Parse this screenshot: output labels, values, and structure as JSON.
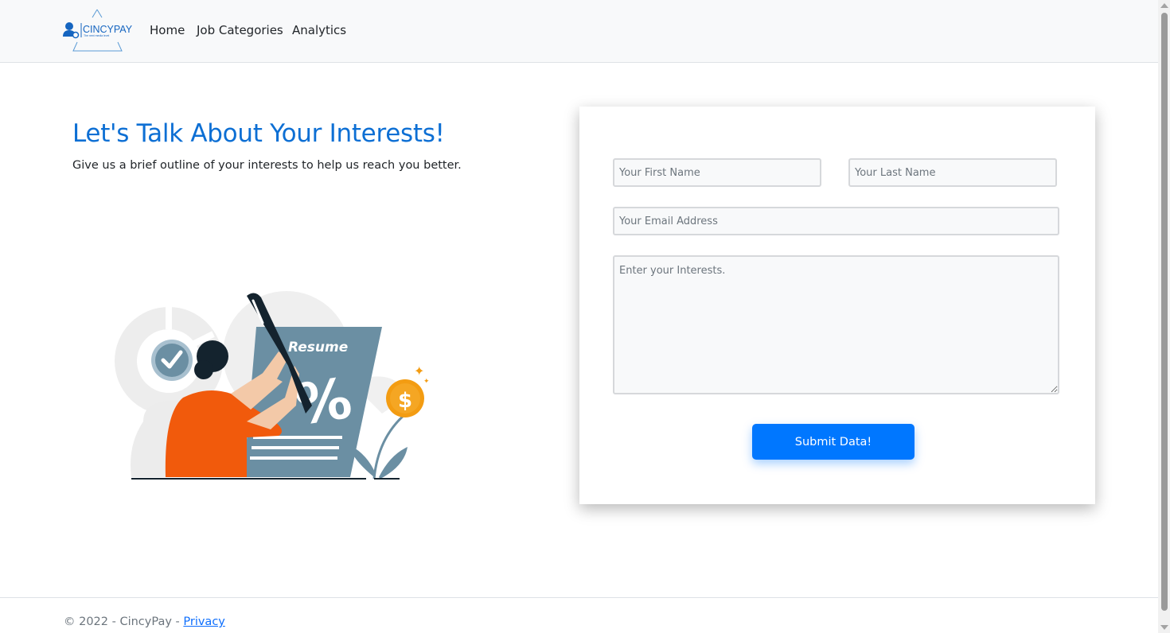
{
  "brand": {
    "name": "CINCYPAY",
    "tagline": "The next media level"
  },
  "nav": {
    "items": [
      {
        "label": "Home"
      },
      {
        "label": "Job Categories"
      },
      {
        "label": "Analytics"
      }
    ]
  },
  "hero": {
    "title": "Let's Talk About Your Interests!",
    "subtitle": "Give us a brief outline of your interests to help us reach you better.",
    "illustration": {
      "document_label": "Resume",
      "icons": [
        "check-icon",
        "dollar-coin-icon",
        "pen-icon"
      ]
    }
  },
  "form": {
    "first_name_placeholder": "Your First Name",
    "last_name_placeholder": "Your Last Name",
    "email_placeholder": "Your Email Address",
    "interests_placeholder": "Enter your Interests.",
    "submit_label": "Submit Data!"
  },
  "footer": {
    "copyright": "© 2022 - CincyPay - ",
    "privacy_label": "Privacy"
  },
  "colors": {
    "accent": "#0077ff",
    "heading": "#0d6fd4",
    "navbar_bg": "#f8f9fa",
    "illustration_orange": "#f15a0c",
    "illustration_slate": "#6b8fa3"
  }
}
